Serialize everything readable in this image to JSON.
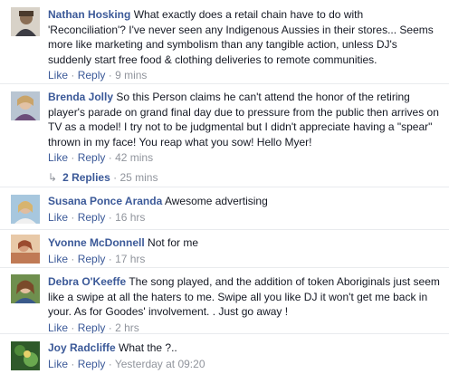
{
  "comments": [
    {
      "author": "Nathan Hosking",
      "text": "What exactly does a retail chain have to do with 'Reconciliation'? I've never seen any Indigenous Aussies in their stores... Seems more like marketing and symbolism than any tangible action, unless DJ's suddenly start free food & clothing deliveries to remote communities.",
      "like": "Like",
      "reply": "Reply",
      "time": "9 mins"
    },
    {
      "author": "Brenda Jolly",
      "text": "So this Person claims he can't attend the honor of the retiring player's parade on grand final day due to pressure from the public then arrives on TV as a model! I try not to be judgmental but I didn't appreciate having a \"spear\" thrown in my face! You reap what you sow! Hello Myer!",
      "like": "Like",
      "reply": "Reply",
      "time": "42 mins",
      "replies_label": "2 Replies",
      "replies_time": "25 mins"
    },
    {
      "author": "Susana Ponce Aranda",
      "text": "Awesome advertising",
      "like": "Like",
      "reply": "Reply",
      "time": "16 hrs"
    },
    {
      "author": "Yvonne McDonnell",
      "text": "Not for me",
      "like": "Like",
      "reply": "Reply",
      "time": "17 hrs"
    },
    {
      "author": "Debra O'Keeffe",
      "text": "The song played, and the addition of token Aboriginals just seem like a swipe at all the haters to me. Swipe all you like DJ it won't get me back in your. As for Goodes' involvement. . Just go away !",
      "like": "Like",
      "reply": "Reply",
      "time": "2 hrs"
    },
    {
      "author": "Joy Radcliffe",
      "text": "What the ?..",
      "like": "Like",
      "reply": "Reply",
      "time": "Yesterday at 09:20"
    }
  ],
  "separator": "·",
  "reply_arrow_icon": "reply-arrow-icon"
}
